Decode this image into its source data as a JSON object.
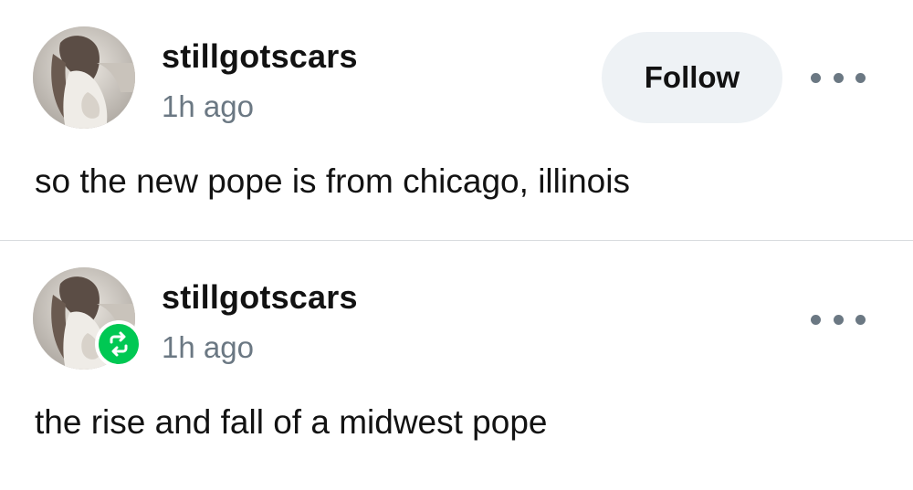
{
  "posts": [
    {
      "username": "stillgotscars",
      "timestamp": "1h ago",
      "follow_label": "Follow",
      "text": "so the new pope is from chicago, illinois",
      "avatar_icon": "user-avatar-photo",
      "more_icon": "more-options-icon"
    },
    {
      "username": "stillgotscars",
      "timestamp": "1h ago",
      "text": "the rise and fall of a midwest pope",
      "avatar_icon": "user-avatar-photo",
      "badge_icon": "reblog-icon",
      "more_icon": "more-options-icon"
    }
  ],
  "colors": {
    "follow_bg": "#eef2f5",
    "secondary_text": "#6b7883",
    "reblog_green": "#00c853",
    "divider": "#d9dcdf"
  }
}
